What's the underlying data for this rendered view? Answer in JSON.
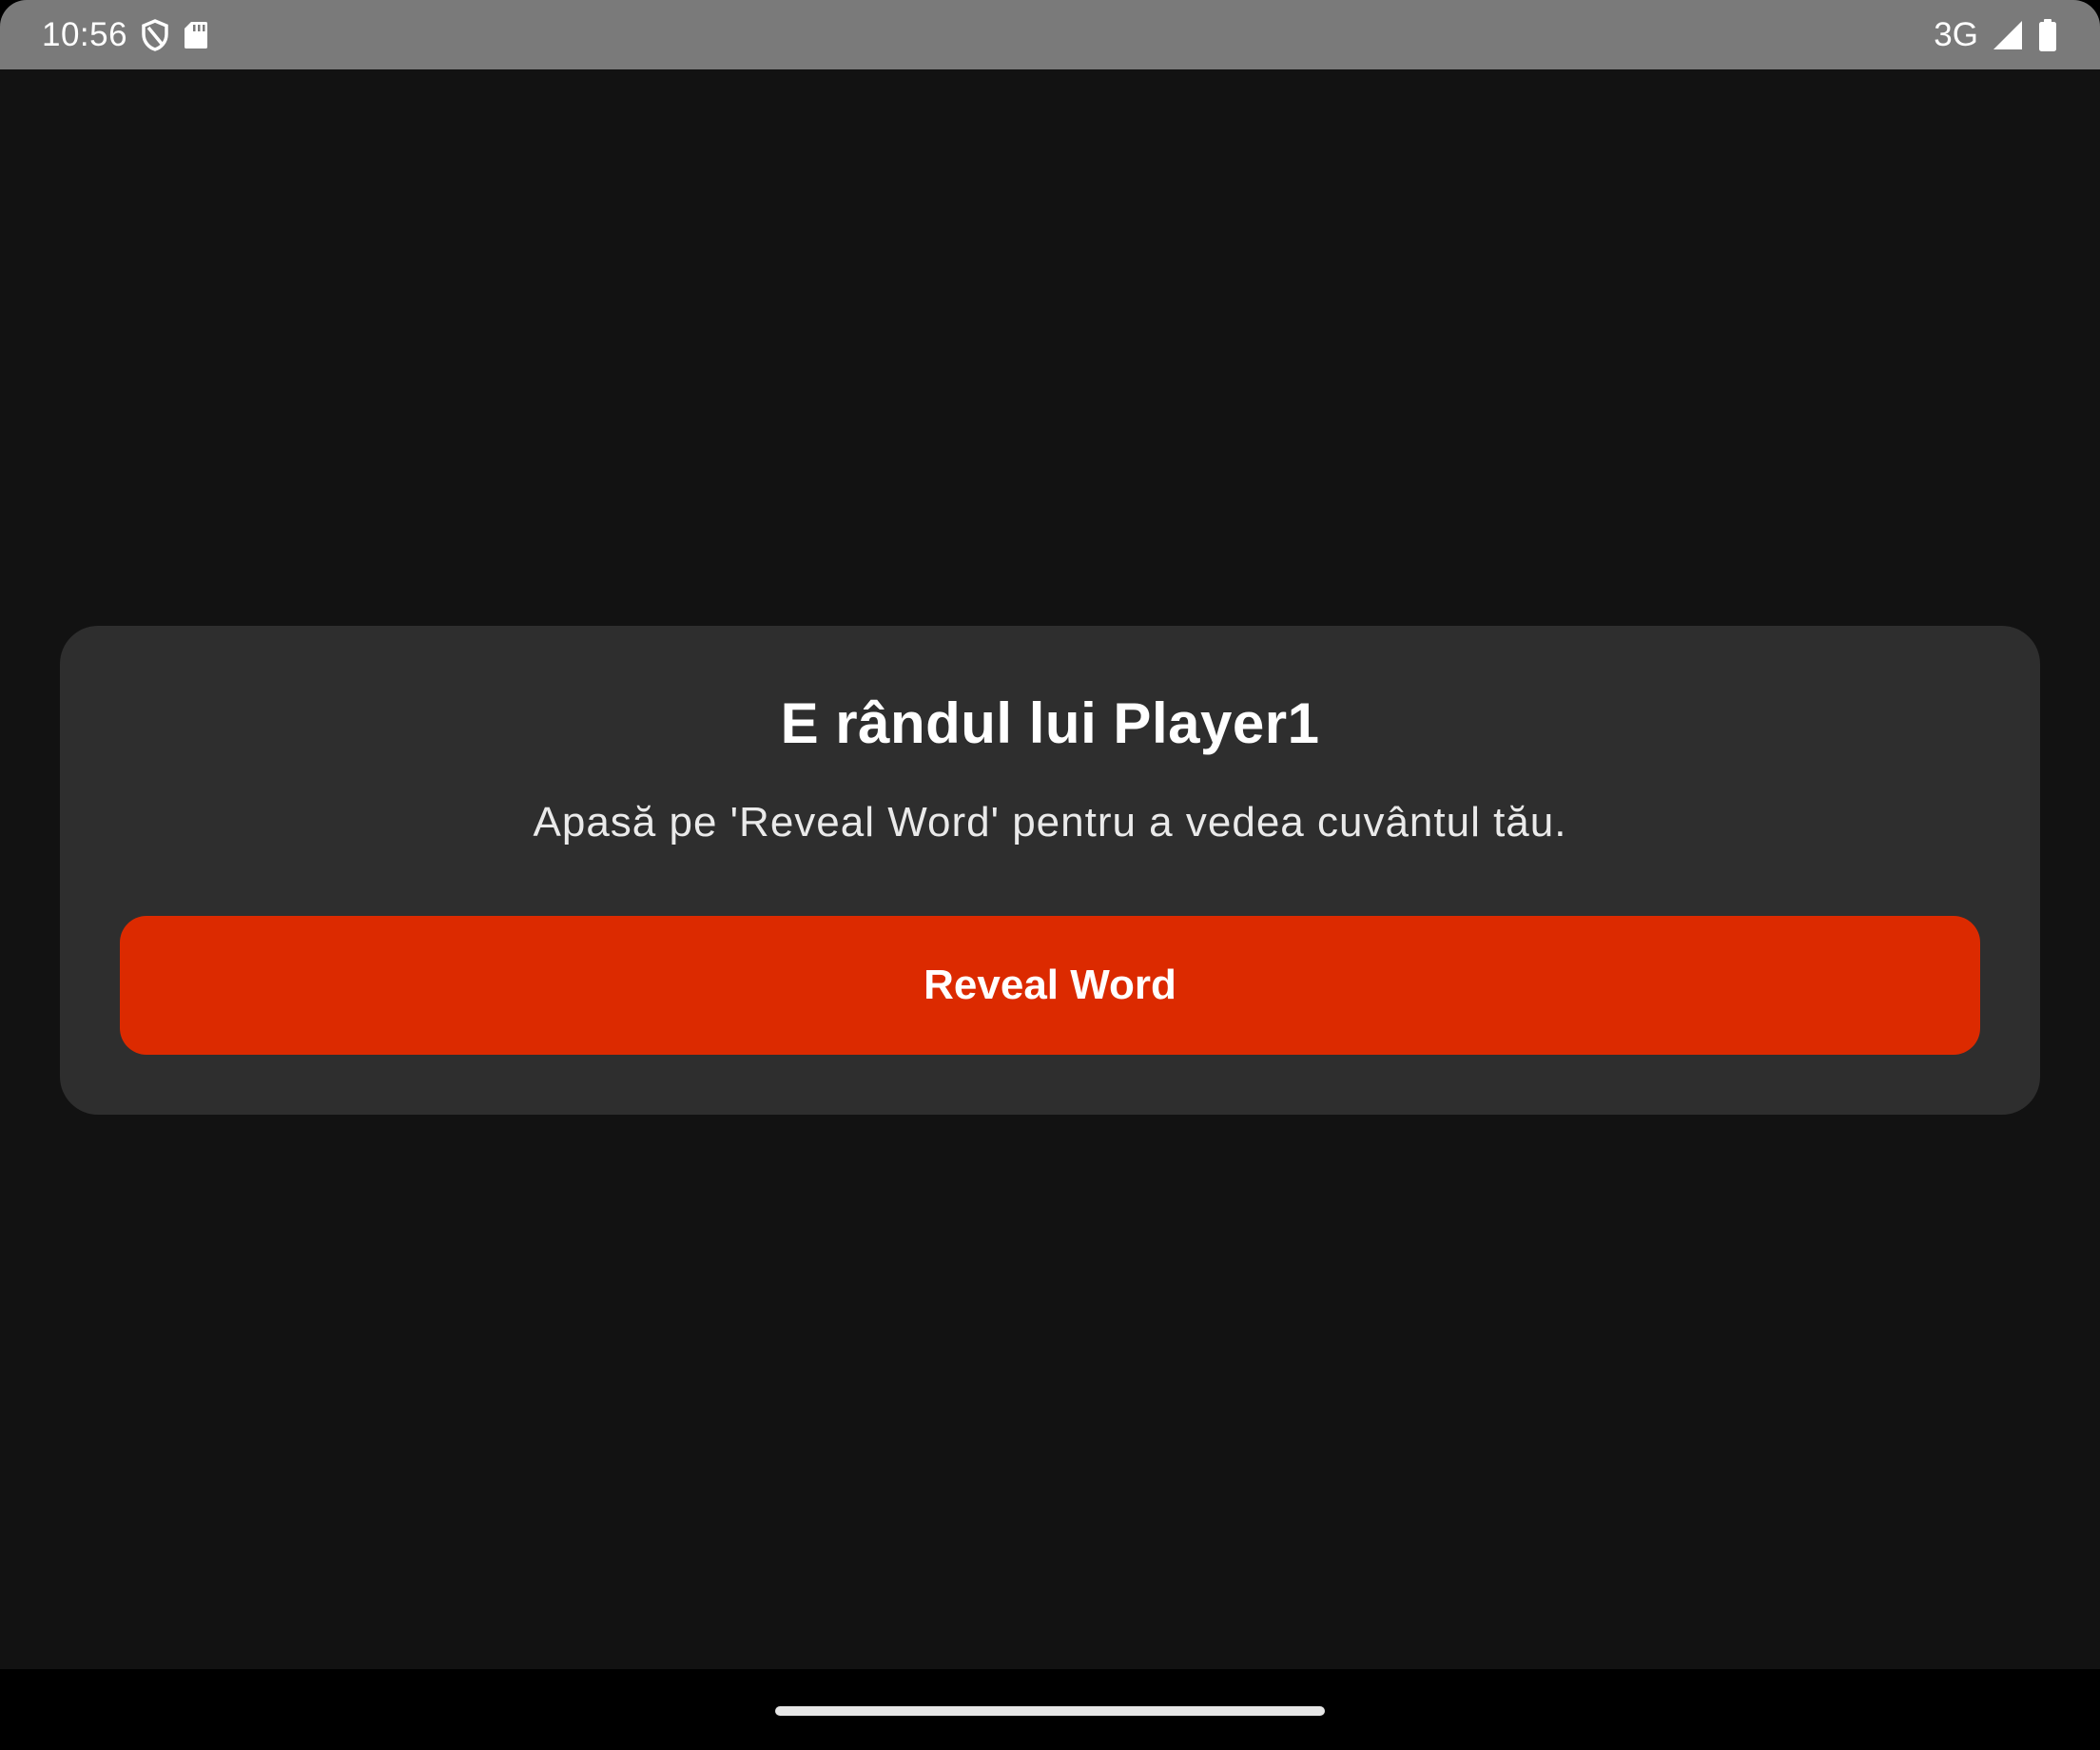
{
  "status_bar": {
    "time": "10:56",
    "network": "3G",
    "icons": [
      "vpn-shield-icon",
      "sd-card-icon",
      "cell-signal-icon",
      "battery-icon"
    ]
  },
  "card": {
    "title": "E rândul lui Player1",
    "subtitle": "Apasă pe 'Reveal Word' pentru a vedea cuvântul tău.",
    "button_label": "Reveal Word"
  },
  "colors": {
    "background": "#121212",
    "status_bar": "#7a7a7a",
    "card": "#2e2e2e",
    "accent": "#dc2a00",
    "nav_bar": "#000000"
  }
}
